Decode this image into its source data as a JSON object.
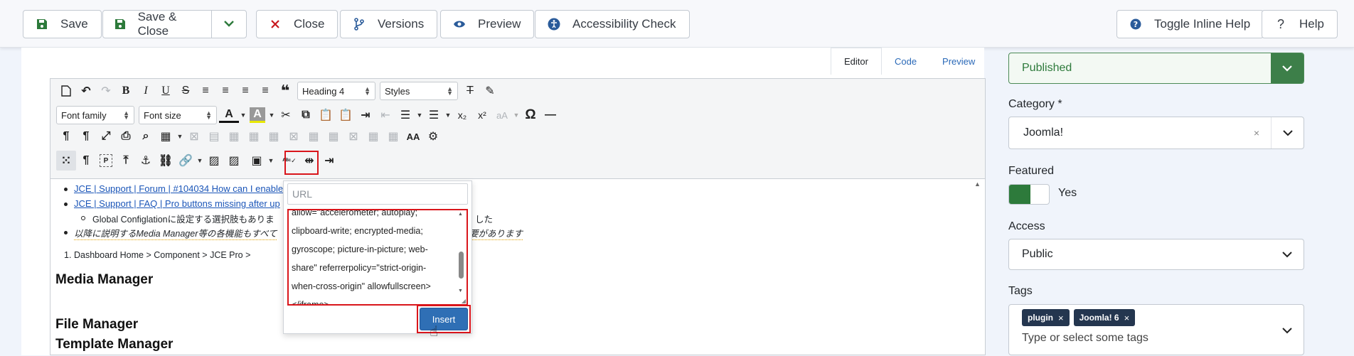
{
  "toolbar": {
    "save": "Save",
    "save_close": "Save & Close",
    "close": "Close",
    "versions": "Versions",
    "preview": "Preview",
    "accessibility": "Accessibility Check",
    "toggle_help": "Toggle Inline Help",
    "help": "Help"
  },
  "editor_tabs": [
    "Editor",
    "Code",
    "Preview"
  ],
  "editor_toolbar": {
    "heading_select": "Heading 4",
    "styles_select": "Styles",
    "font_family_select": "Font family",
    "font_size_select": "Font size"
  },
  "editor_content": {
    "link1": "JCE | Support | Forum | #104034 How can I enable",
    "link2": "JCE | Support | FAQ | Pro buttons missing after up",
    "sub_item_start": "Global Configlationに設定する選択肢もありま",
    "sub_item_end": "した",
    "note_start": "以降に説明するMedia Manager等の各機能もすべて",
    "note_end": "要があります",
    "ordered_item": "Dashboard Home > Component > JCE Pro >",
    "heading_media": "Media Manager",
    "heading_file": "File Manager",
    "heading_template": "Template Manager"
  },
  "media_popup": {
    "url_placeholder": "URL",
    "embed_code_lines": [
      "allow=\"accelerometer; autoplay;",
      "clipboard-write; encrypted-media;",
      "gyroscope; picture-in-picture; web-",
      "share\" referrerpolicy=\"strict-origin-",
      "when-cross-origin\" allowfullscreen>",
      "</iframe>"
    ],
    "insert_label": "Insert"
  },
  "sidebar": {
    "status_value": "Published",
    "category_label": "Category *",
    "category_value": "Joomla!",
    "featured_label": "Featured",
    "featured_value": "Yes",
    "access_label": "Access",
    "access_value": "Public",
    "tags_label": "Tags",
    "tags": [
      "plugin",
      "Joomla! 6"
    ],
    "tags_placeholder": "Type or select some tags"
  },
  "colors": {
    "accent_green": "#2d7a3b",
    "highlight_red": "#d9151b",
    "insert_blue": "#2f6fb5",
    "link_blue": "#1a55b8"
  }
}
